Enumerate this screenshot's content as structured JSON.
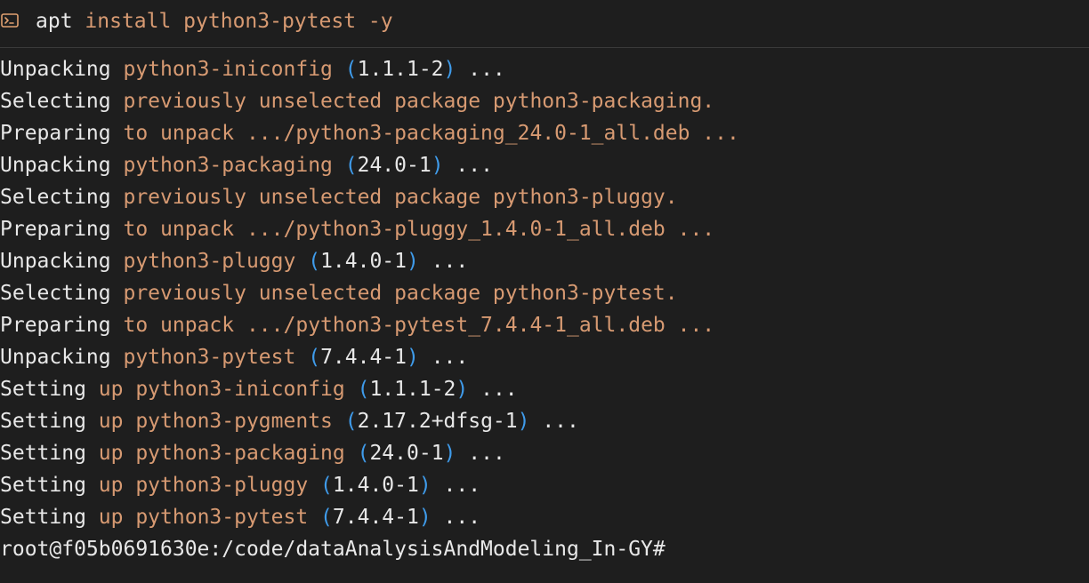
{
  "header": {
    "icon": "terminal-icon",
    "command": {
      "name": "apt",
      "args": "install python3-pytest -y"
    }
  },
  "colors": {
    "background": "#1e1e1e",
    "plain_text": "#e8e8e8",
    "argument": "#d79a72",
    "parenthesis": "#3f9bea",
    "icon": "#e0a070"
  },
  "lines": [
    {
      "cmd": "Unpacking",
      "text": "python3-iniconfig ",
      "lp": "(",
      "ver": "1.1.1-2",
      "rp": ")",
      "tail": " ..."
    },
    {
      "cmd": "Selecting",
      "text": "previously unselected package python3-packaging.",
      "lp": "",
      "ver": "",
      "rp": "",
      "tail": ""
    },
    {
      "cmd": "Preparing",
      "text": "to unpack .../python3-packaging_24.0-1_all.deb ...",
      "lp": "",
      "ver": "",
      "rp": "",
      "tail": ""
    },
    {
      "cmd": "Unpacking",
      "text": "python3-packaging ",
      "lp": "(",
      "ver": "24.0-1",
      "rp": ")",
      "tail": " ..."
    },
    {
      "cmd": "Selecting",
      "text": "previously unselected package python3-pluggy.",
      "lp": "",
      "ver": "",
      "rp": "",
      "tail": ""
    },
    {
      "cmd": "Preparing",
      "text": "to unpack .../python3-pluggy_1.4.0-1_all.deb ...",
      "lp": "",
      "ver": "",
      "rp": "",
      "tail": ""
    },
    {
      "cmd": "Unpacking",
      "text": "python3-pluggy ",
      "lp": "(",
      "ver": "1.4.0-1",
      "rp": ")",
      "tail": " ..."
    },
    {
      "cmd": "Selecting",
      "text": "previously unselected package python3-pytest.",
      "lp": "",
      "ver": "",
      "rp": "",
      "tail": ""
    },
    {
      "cmd": "Preparing",
      "text": "to unpack .../python3-pytest_7.4.4-1_all.deb ...",
      "lp": "",
      "ver": "",
      "rp": "",
      "tail": ""
    },
    {
      "cmd": "Unpacking",
      "text": "python3-pytest ",
      "lp": "(",
      "ver": "7.4.4-1",
      "rp": ")",
      "tail": " ..."
    },
    {
      "cmd": "Setting",
      "text": "up python3-iniconfig ",
      "lp": "(",
      "ver": "1.1.1-2",
      "rp": ")",
      "tail": " ..."
    },
    {
      "cmd": "Setting",
      "text": "up python3-pygments ",
      "lp": "(",
      "ver": "2.17.2+dfsg-1",
      "rp": ")",
      "tail": " ..."
    },
    {
      "cmd": "Setting",
      "text": "up python3-packaging ",
      "lp": "(",
      "ver": "24.0-1",
      "rp": ")",
      "tail": " ..."
    },
    {
      "cmd": "Setting",
      "text": "up python3-pluggy ",
      "lp": "(",
      "ver": "1.4.0-1",
      "rp": ")",
      "tail": " ..."
    },
    {
      "cmd": "Setting",
      "text": "up python3-pytest ",
      "lp": "(",
      "ver": "7.4.4-1",
      "rp": ")",
      "tail": " ..."
    }
  ],
  "prompt": "root@f05b0691630e:/code/dataAnalysisAndModeling_In-GY#"
}
